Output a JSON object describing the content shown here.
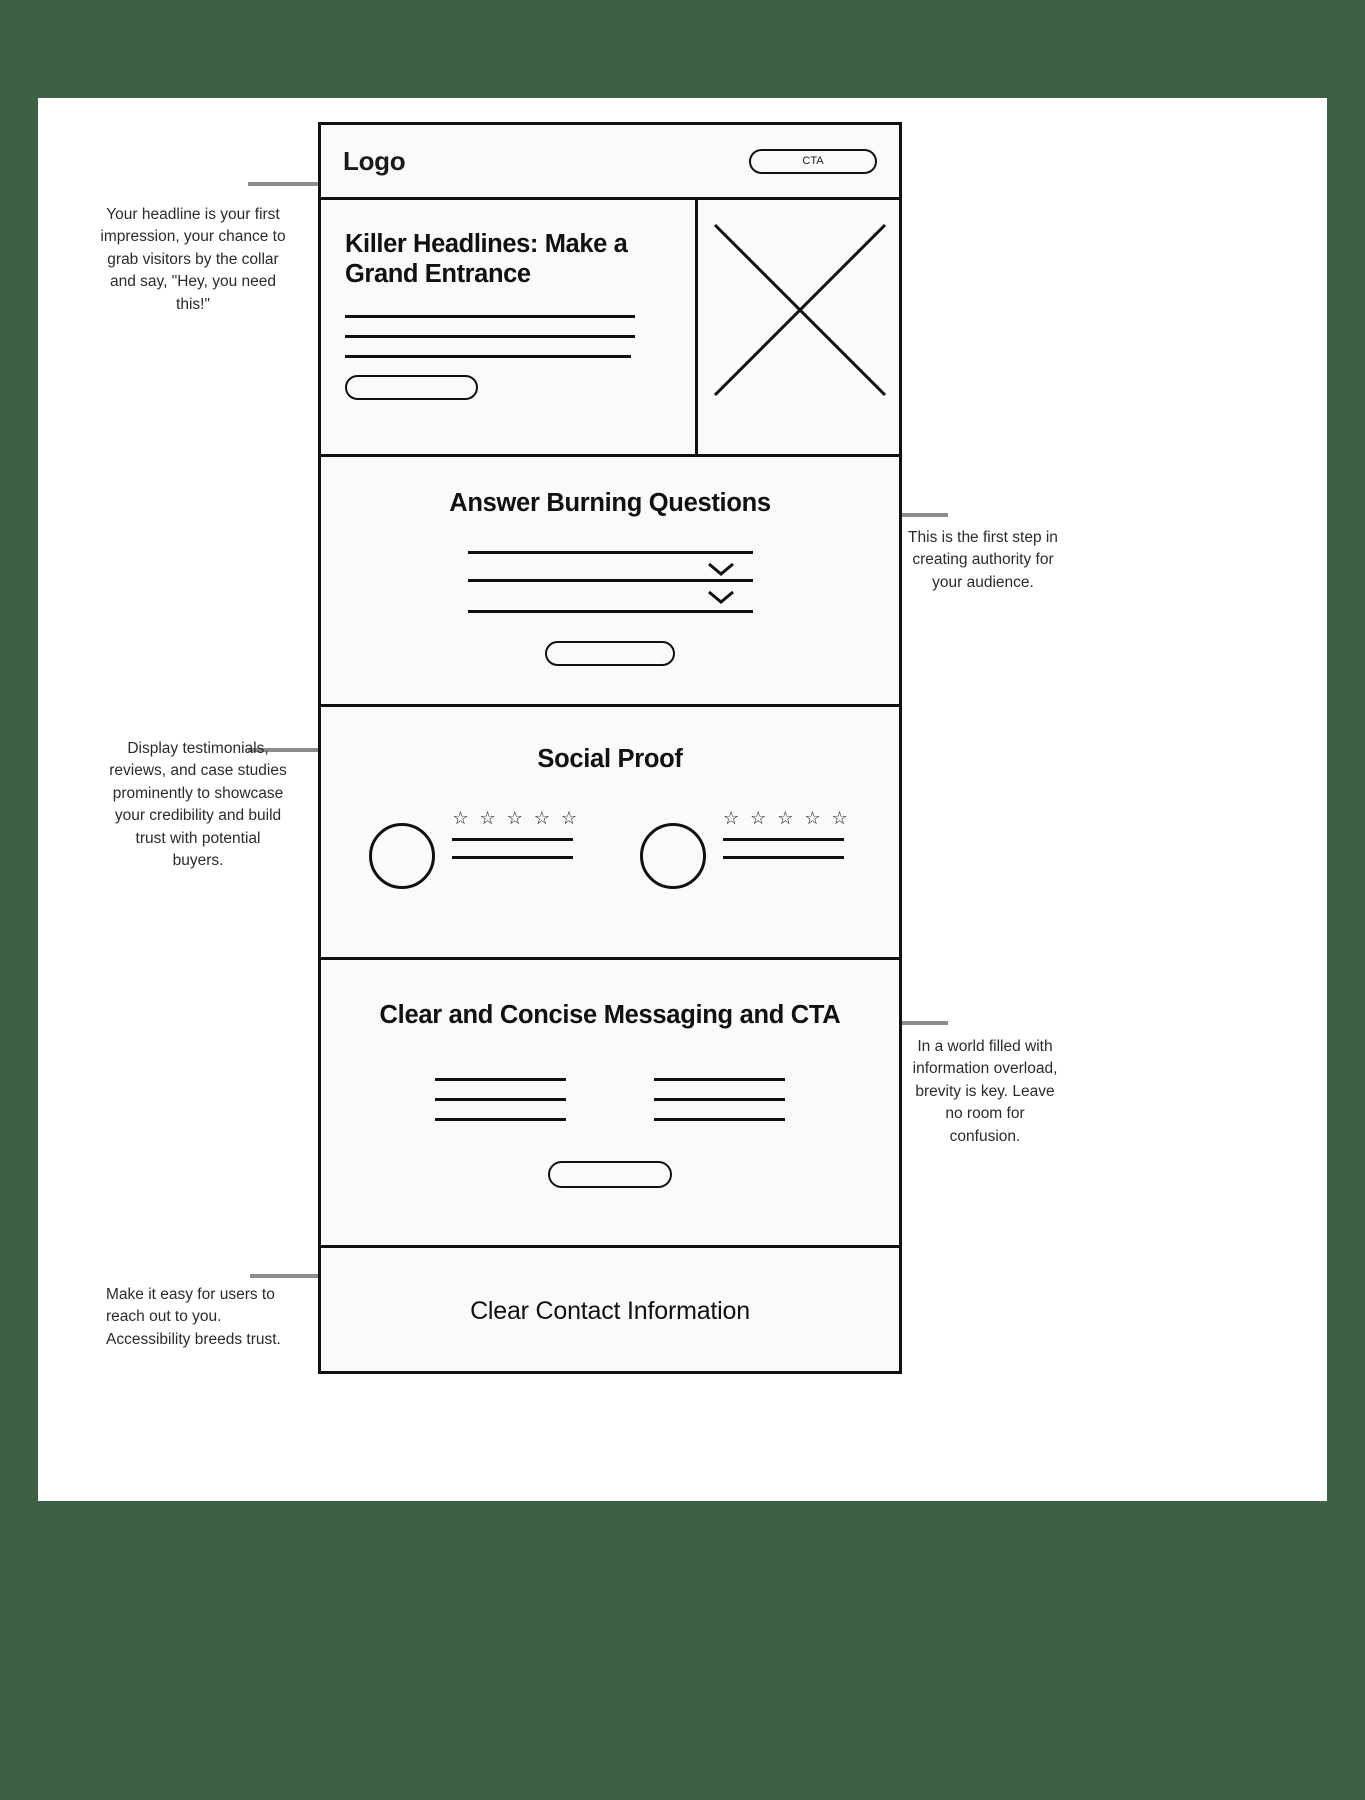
{
  "canvas": {
    "background": "#3e6145",
    "sheet": "#ffffff",
    "ink": "#111111",
    "leader": "#8c8c8c"
  },
  "wireframe": {
    "header": {
      "logo": "Logo",
      "cta_label": "CTA"
    },
    "hero": {
      "headline": "Killer Headlines: Make a Grand Entrance",
      "placeholder_lines": 3,
      "button_label": "",
      "image_placeholder": "x-cross-image-placeholder"
    },
    "faq": {
      "title": "Answer Burning Questions",
      "rows": [
        {
          "chevron": "chevron-down-icon"
        },
        {
          "chevron": "chevron-down-icon"
        }
      ],
      "button_label": ""
    },
    "social_proof": {
      "title": "Social Proof",
      "cards": [
        {
          "avatar": "avatar-circle",
          "stars": "☆ ☆ ☆ ☆ ☆",
          "star_count": 5,
          "lines": 2
        },
        {
          "avatar": "avatar-circle",
          "stars": "☆ ☆ ☆ ☆ ☆",
          "star_count": 5,
          "lines": 2
        }
      ]
    },
    "messaging": {
      "title": "Clear and Concise Messaging and CTA",
      "columns": [
        {
          "lines": 3
        },
        {
          "lines": 3
        }
      ],
      "button_label": ""
    },
    "contact": {
      "title": "Clear Contact Information"
    }
  },
  "annotations": {
    "headline": "Your headline is your first impression, your chance to grab visitors by the collar and say, \"Hey, you need this!\"",
    "faq": "This is the first step in creating authority for your audience.",
    "social_proof": "Display testimonials, reviews, and case studies prominently to showcase your credibility and build trust with potential buyers.",
    "messaging": "In a world filled with information overload, brevity is key. Leave no room for confusion.",
    "contact": "Make it easy for users to reach out to you. Accessibility breeds trust."
  }
}
